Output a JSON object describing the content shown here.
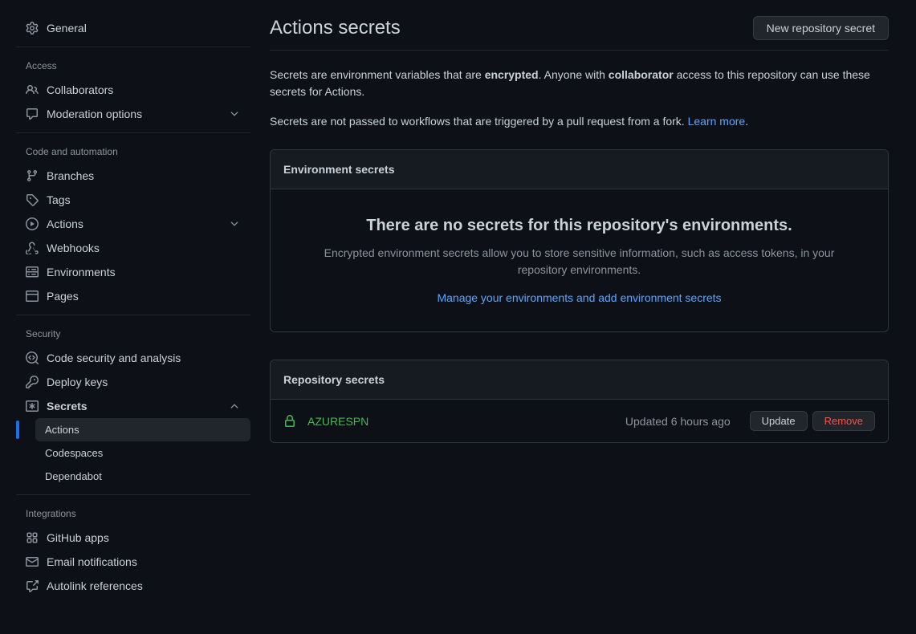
{
  "sidebar": {
    "general": "General",
    "section_access": "Access",
    "access": {
      "collaborators": "Collaborators",
      "moderation": "Moderation options"
    },
    "section_code": "Code and automation",
    "code": {
      "branches": "Branches",
      "tags": "Tags",
      "actions": "Actions",
      "webhooks": "Webhooks",
      "environments": "Environments",
      "pages": "Pages"
    },
    "section_security": "Security",
    "security": {
      "code_security": "Code security and analysis",
      "deploy_keys": "Deploy keys",
      "secrets": "Secrets",
      "secrets_sub": {
        "actions": "Actions",
        "codespaces": "Codespaces",
        "dependabot": "Dependabot"
      }
    },
    "section_integrations": "Integrations",
    "integrations": {
      "github_apps": "GitHub apps",
      "email": "Email notifications",
      "autolink": "Autolink references"
    }
  },
  "main": {
    "title": "Actions secrets",
    "new_secret_btn": "New repository secret",
    "desc_part1": "Secrets are environment variables that are ",
    "desc_encrypted": "encrypted",
    "desc_part2": ". Anyone with ",
    "desc_collaborator": "collaborator",
    "desc_part3": " access to this repository can use these secrets for Actions.",
    "desc2_part1": "Secrets are not passed to workflows that are triggered by a pull request from a fork. ",
    "desc2_link": "Learn more",
    "desc2_period": ".",
    "env_panel": {
      "header": "Environment secrets",
      "empty_title": "There are no secrets for this repository's environments.",
      "empty_text": "Encrypted environment secrets allow you to store sensitive information, such as access tokens, in your repository environments.",
      "manage_link": "Manage your environments and add environment secrets"
    },
    "repo_panel": {
      "header": "Repository secrets",
      "secret_name": "AZURESPN",
      "updated": "Updated 6 hours ago",
      "update_btn": "Update",
      "remove_btn": "Remove"
    }
  }
}
